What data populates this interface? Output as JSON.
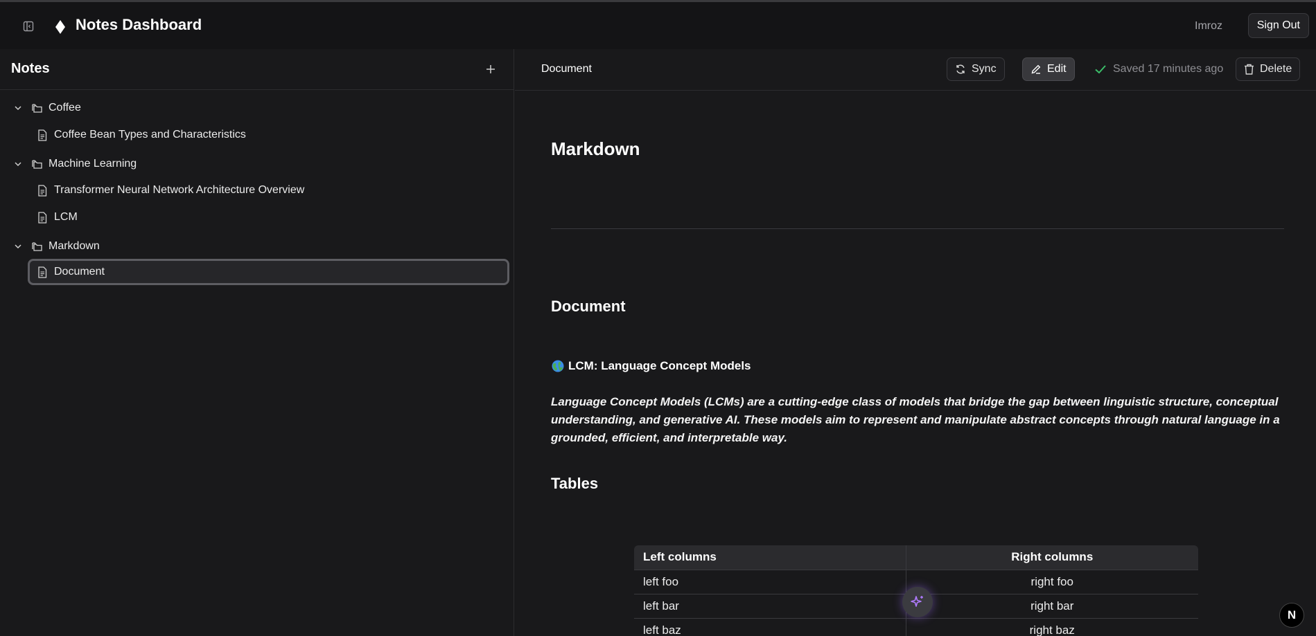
{
  "header": {
    "app_title": "Notes Dashboard",
    "username": "Imroz",
    "signout_label": "Sign Out",
    "icons": [
      "sidebar-toggle-icon",
      "diamond-logo-icon"
    ]
  },
  "sidebar": {
    "title": "Notes",
    "add_icon": "plus-icon",
    "folders": [
      {
        "label": "Coffee",
        "notes": [
          "Coffee Bean Types and Characteristics"
        ]
      },
      {
        "label": "Machine Learning",
        "notes": [
          "Transformer Neural Network Architecture Overview",
          "LCM"
        ]
      },
      {
        "label": "Markdown",
        "notes": [
          "Document"
        ]
      }
    ],
    "active_note": "Document"
  },
  "toolbar": {
    "crumb": "Document",
    "sync_label": "Sync",
    "edit_label": "Edit",
    "saved_text": "Saved 17 minutes ago",
    "delete_label": "Delete"
  },
  "document": {
    "h1": "Markdown",
    "h2": "Document",
    "lcm_title": "LCM: Language Concept Models",
    "lcm_paragraph": "Language Concept Models (LCMs) are a cutting-edge class of models that bridge the gap between linguistic structure, conceptual understanding, and generative AI. These models aim to represent and manipulate abstract concepts through natural language in a grounded, efficient, and interpretable way.",
    "tables_heading": "Tables",
    "table": {
      "headers": [
        "Left columns",
        "Right columns"
      ],
      "rows": [
        [
          "left foo",
          "right foo"
        ],
        [
          "left bar",
          "right bar"
        ],
        [
          "left baz",
          "right baz"
        ]
      ]
    }
  },
  "floating": {
    "ai_icon": "sparkles-icon",
    "badge_label": "N"
  },
  "colors": {
    "background": "#19191b",
    "header": "#141416",
    "saved_check": "#3bbf6a",
    "ai_glow": "#a06eff"
  }
}
